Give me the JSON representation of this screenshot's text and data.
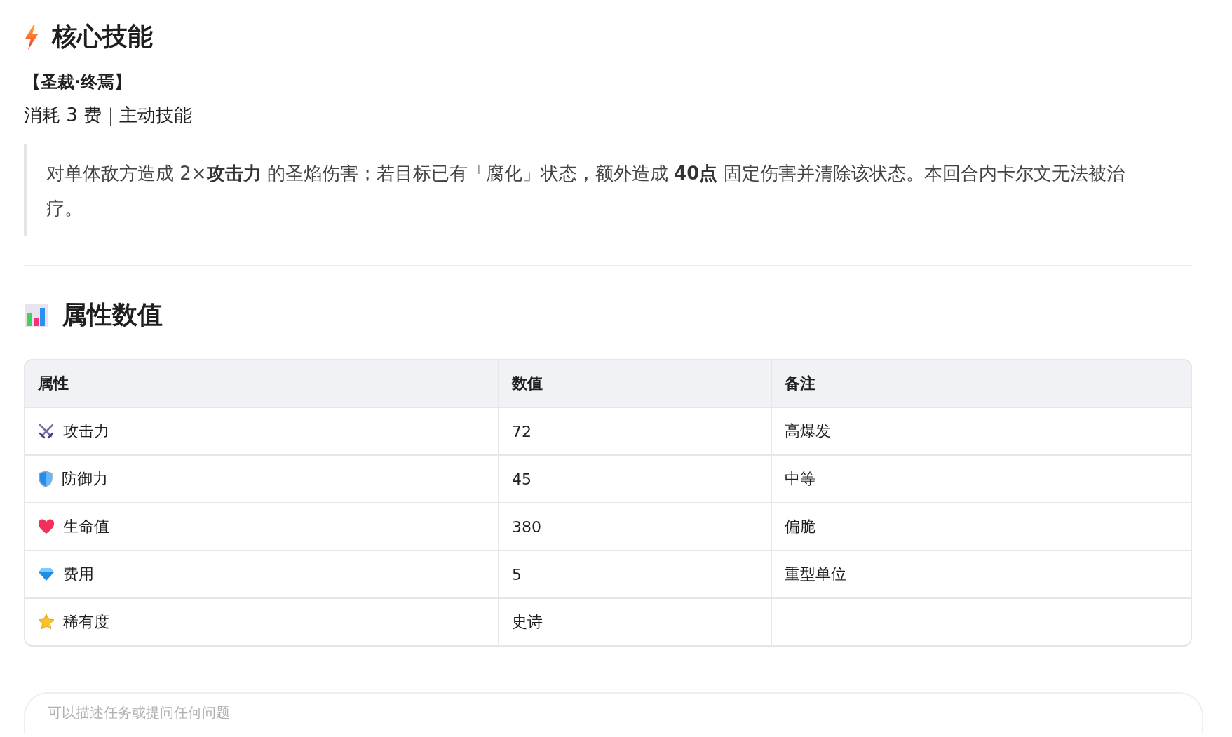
{
  "skill_section": {
    "title": "核心技能",
    "skill_name": "【圣裁·终焉】",
    "cost_line": "消耗 3 费｜主动技能",
    "description": "对单体敌方造成 2×**攻击力** 的圣焰伤害；若目标已有「腐化」状态，额外造成 **40点** 固定伤害并清除该状态。本回合内卡尔文无法被治疗。"
  },
  "stats_section": {
    "title": "属性数值",
    "table": {
      "columns": [
        "属性",
        "数值",
        "备注"
      ],
      "rows": [
        {
          "name": "攻击力",
          "value": "72",
          "note": "高爆发"
        },
        {
          "name": "防御力",
          "value": "45",
          "note": "中等"
        },
        {
          "name": "生命值",
          "value": "380",
          "note": "偏脆"
        },
        {
          "name": "费用",
          "value": "5",
          "note": "重型单位"
        },
        {
          "name": "稀有度",
          "value": "史诗",
          "note": ""
        }
      ]
    }
  },
  "chat_input": {
    "placeholder": "可以描述任务或提问任何问题"
  }
}
